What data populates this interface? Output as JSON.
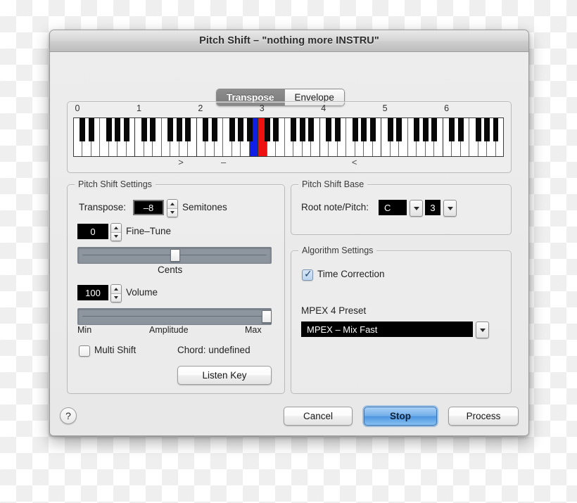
{
  "window": {
    "title": "Pitch Shift – \"nothing more INSTRU\""
  },
  "tabs": [
    {
      "label": "Transpose",
      "active": true
    },
    {
      "label": "Envelope",
      "active": false
    }
  ],
  "keyboard": {
    "octave_labels": [
      "0",
      "1",
      "2",
      "3",
      "4",
      "5",
      "6"
    ],
    "markers": [
      {
        "glyph": ">",
        "x_pct": 25.0
      },
      {
        "glyph": "–",
        "x_pct": 34.9
      },
      {
        "glyph": "<",
        "x_pct": 65.3
      }
    ],
    "highlight_blue_note": "B2",
    "highlight_red_note": "C3",
    "blue_color": "#0f1fe8",
    "red_color": "#ee1111"
  },
  "pitch_shift_settings": {
    "group_title": "Pitch Shift Settings",
    "transpose_label": "Transpose:",
    "transpose_value": "–8",
    "transpose_unit": "Semitones",
    "fine_tune_value": "0",
    "fine_tune_label": "Fine–Tune",
    "cents_label": "Cents",
    "cents_slider_pct": 50,
    "volume_value": "100",
    "volume_label": "Volume",
    "amplitude_min_label": "Min",
    "amplitude_label": "Amplitude",
    "amplitude_max_label": "Max",
    "amplitude_slider_pct": 100,
    "multi_shift_label": "Multi Shift",
    "multi_shift_checked": false,
    "chord_label": "Chord: undefined",
    "listen_key_label": "Listen Key"
  },
  "pitch_shift_base": {
    "group_title": "Pitch Shift Base",
    "root_note_label": "Root note/Pitch:",
    "root_note_value": "C",
    "pitch_value": "3"
  },
  "algorithm_settings": {
    "group_title": "Algorithm Settings",
    "time_correction_label": "Time Correction",
    "time_correction_checked": true,
    "preset_label": "MPEX 4 Preset",
    "preset_value": "MPEX – Mix Fast"
  },
  "footer": {
    "help_label": "?",
    "cancel_label": "Cancel",
    "stop_label": "Stop",
    "process_label": "Process",
    "default_button": "Stop",
    "accent_color": "#4f97e2"
  }
}
